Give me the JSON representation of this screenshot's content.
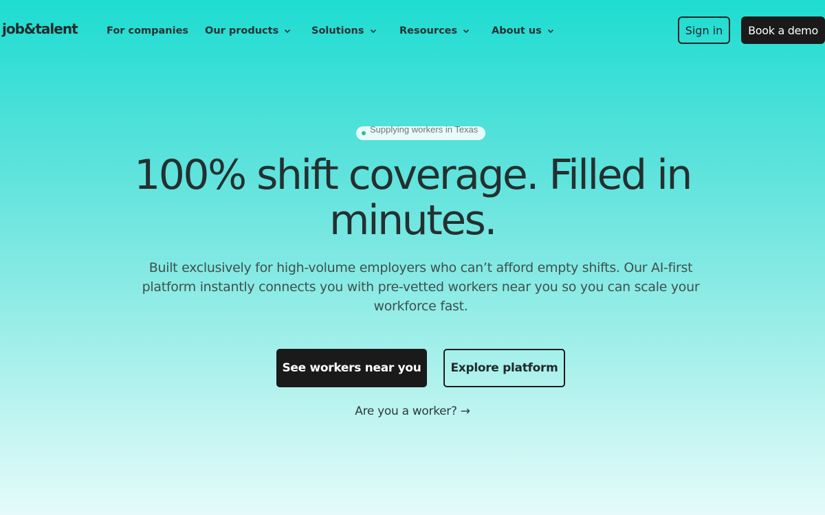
{
  "header": {
    "logo": "job&talent",
    "nav": [
      {
        "label": "For companies",
        "has_dropdown": false
      },
      {
        "label": "Our products",
        "has_dropdown": true
      },
      {
        "label": "Solutions",
        "has_dropdown": true
      },
      {
        "label": "Resources",
        "has_dropdown": true
      },
      {
        "label": "About us",
        "has_dropdown": true
      }
    ],
    "signin_label": "Sign in",
    "demo_label": "Book a demo"
  },
  "hero": {
    "badge": "Supplying workers in Texas",
    "headline_line1": "100% shift coverage. Filled in",
    "headline_line2": "minutes.",
    "subtext": "Built exclusively for high-volume employers who can’t afford empty shifts. Our AI-first platform instantly connects you with pre-vetted workers near you so you can scale your workforce fast.",
    "primary_cta": "See workers near you",
    "secondary_cta": "Explore platform",
    "worker_link": "Are you a worker? →"
  },
  "colors": {
    "gradient_top": "#1edcd1",
    "gradient_bottom": "#e4fbfa",
    "dark": "#1a1a1a",
    "badge_dot": "#2bbf8f"
  },
  "icons": {
    "dropdown": "chevron-down-icon",
    "badge_dot": "status-dot-icon"
  }
}
